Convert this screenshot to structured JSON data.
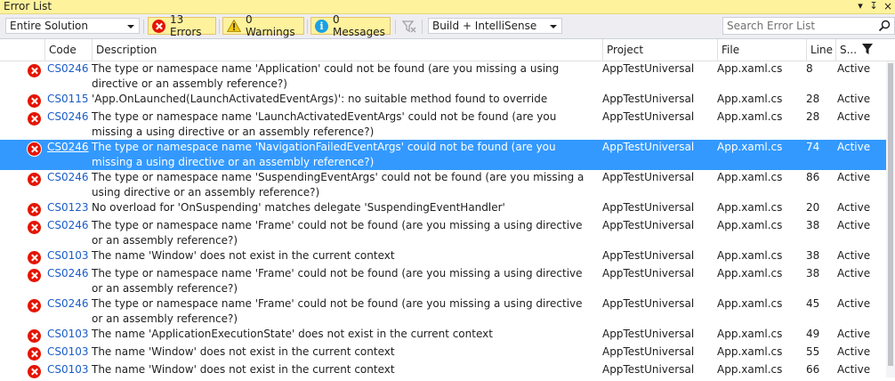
{
  "window": {
    "title": "Error List"
  },
  "toolbar": {
    "scope": "Entire Solution",
    "errors_label": "13 Errors",
    "warnings_label": "0 Warnings",
    "messages_label": "0 Messages",
    "build_source": "Build + IntelliSense",
    "search_placeholder": "Search Error List"
  },
  "columns": {
    "code": "Code",
    "description": "Description",
    "project": "Project",
    "file": "File",
    "line": "Line",
    "state": "S..."
  },
  "colors": {
    "error": "#e51400",
    "info": "#1ba1e2",
    "selection": "#3399ff",
    "titlebar": "#fff29d",
    "link": "#1a5cc8"
  },
  "rows": [
    {
      "code": "CS0246",
      "description": "The type or namespace name 'Application' could not be found (are you missing a using directive or an assembly reference?)",
      "project": "AppTestUniversal",
      "file": "App.xaml.cs",
      "line": "8",
      "state": "Active",
      "icon": "error-icon"
    },
    {
      "code": "CS0115",
      "description": "'App.OnLaunched(LaunchActivatedEventArgs)': no suitable method found to override",
      "project": "AppTestUniversal",
      "file": "App.xaml.cs",
      "line": "28",
      "state": "Active",
      "icon": "error-icon"
    },
    {
      "code": "CS0246",
      "description": "The type or namespace name 'LaunchActivatedEventArgs' could not be found (are you missing a using directive or an assembly reference?)",
      "project": "AppTestUniversal",
      "file": "App.xaml.cs",
      "line": "28",
      "state": "Active",
      "icon": "error-icon"
    },
    {
      "code": "CS0246",
      "description": "The type or namespace name 'NavigationFailedEventArgs' could not be found (are you missing a using directive or an assembly reference?)",
      "project": "AppTestUniversal",
      "file": "App.xaml.cs",
      "line": "74",
      "state": "Active",
      "icon": "error-icon",
      "selected": true
    },
    {
      "code": "CS0246",
      "description": "The type or namespace name 'SuspendingEventArgs' could not be found (are you missing a using directive or an assembly reference?)",
      "project": "AppTestUniversal",
      "file": "App.xaml.cs",
      "line": "86",
      "state": "Active",
      "icon": "error-icon"
    },
    {
      "code": "CS0123",
      "description": "No overload for 'OnSuspending' matches delegate 'SuspendingEventHandler'",
      "project": "AppTestUniversal",
      "file": "App.xaml.cs",
      "line": "20",
      "state": "Active",
      "icon": "error-icon"
    },
    {
      "code": "CS0246",
      "description": "The type or namespace name 'Frame' could not be found (are you missing a using directive or an assembly reference?)",
      "project": "AppTestUniversal",
      "file": "App.xaml.cs",
      "line": "38",
      "state": "Active",
      "icon": "error-icon"
    },
    {
      "code": "CS0103",
      "description": "The name 'Window' does not exist in the current context",
      "project": "AppTestUniversal",
      "file": "App.xaml.cs",
      "line": "38",
      "state": "Active",
      "icon": "error-icon"
    },
    {
      "code": "CS0246",
      "description": "The type or namespace name 'Frame' could not be found (are you missing a using directive or an assembly reference?)",
      "project": "AppTestUniversal",
      "file": "App.xaml.cs",
      "line": "38",
      "state": "Active",
      "icon": "error-icon"
    },
    {
      "code": "CS0246",
      "description": "The type or namespace name 'Frame' could not be found (are you missing a using directive or an assembly reference?)",
      "project": "AppTestUniversal",
      "file": "App.xaml.cs",
      "line": "45",
      "state": "Active",
      "icon": "error-icon"
    },
    {
      "code": "CS0103",
      "description": "The name 'ApplicationExecutionState' does not exist in the current context",
      "project": "AppTestUniversal",
      "file": "App.xaml.cs",
      "line": "49",
      "state": "Active",
      "icon": "error-icon"
    },
    {
      "code": "CS0103",
      "description": "The name 'Window' does not exist in the current context",
      "project": "AppTestUniversal",
      "file": "App.xaml.cs",
      "line": "55",
      "state": "Active",
      "icon": "error-icon"
    },
    {
      "code": "CS0103",
      "description": "The name 'Window' does not exist in the current context",
      "project": "AppTestUniversal",
      "file": "App.xaml.cs",
      "line": "66",
      "state": "Active",
      "icon": "error-icon"
    }
  ]
}
